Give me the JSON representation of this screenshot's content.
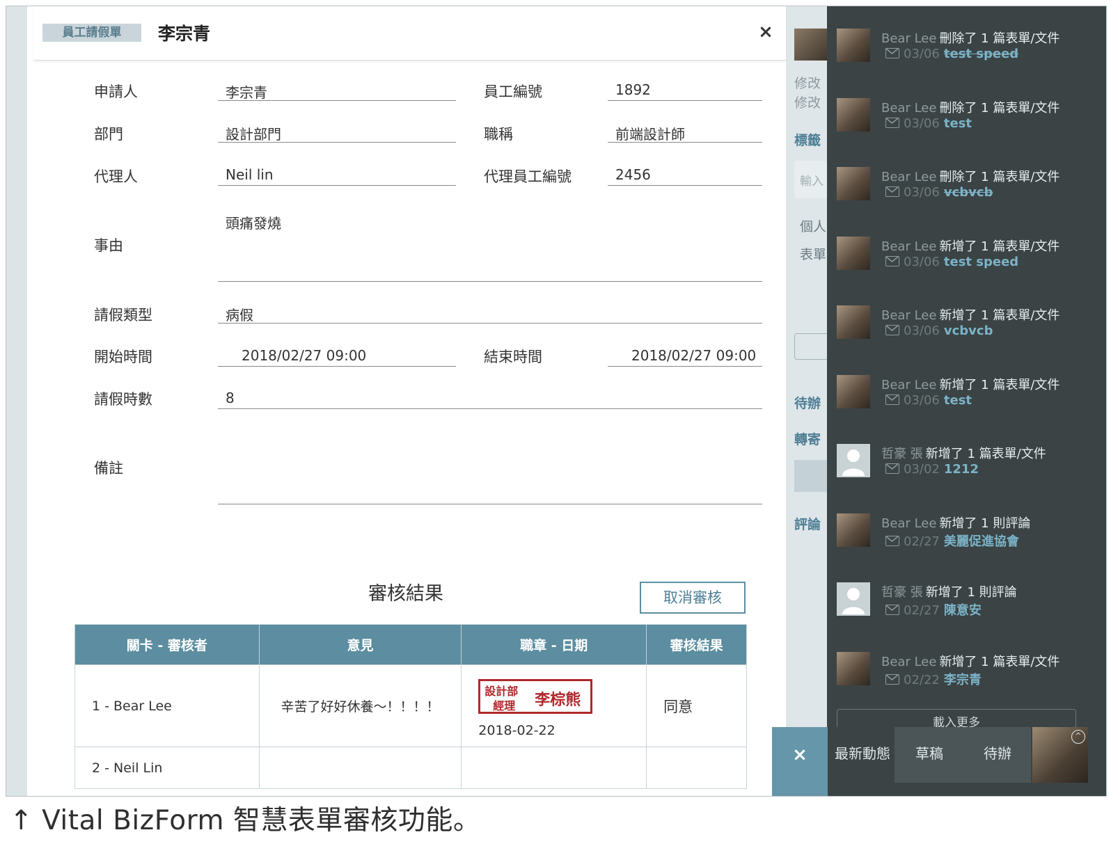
{
  "form": {
    "tag": "員工請假單",
    "title": "李宗青",
    "close": "×",
    "fields": {
      "applicant_label": "申請人",
      "applicant_value": "李宗青",
      "emp_no_label": "員工編號",
      "emp_no_value": "1892",
      "dept_label": "部門",
      "dept_value": "設計部門",
      "job_label": "職稱",
      "job_value": "前端設計師",
      "agent_label": "代理人",
      "agent_value": "Neil lin",
      "agent_no_label": "代理員工編號",
      "agent_no_value": "2456",
      "reason_label": "事由",
      "reason_value": "頭痛發燒",
      "leave_type_label": "請假類型",
      "leave_type_value": "病假",
      "start_label": "開始時間",
      "start_value": "2018/02/27 09:00",
      "end_label": "結束時間",
      "end_value": "2018/02/27 09:00",
      "hours_label": "請假時數",
      "hours_value": "8",
      "note_label": "備註",
      "note_value": ""
    }
  },
  "review": {
    "title": "審核結果",
    "cancel_button": "取消審核",
    "headers": [
      "關卡 - 審核者",
      "意見",
      "職章 - 日期",
      "審核結果"
    ],
    "rows": [
      {
        "stage": "1 - Bear Lee",
        "comment": "辛苦了好好休養～！！！！",
        "stamp_dept": "設計部",
        "stamp_title": "經理",
        "stamp_name": "李棕熊",
        "date": "2018-02-22",
        "result": "同意"
      },
      {
        "stage": "2 - Neil Lin",
        "comment": "",
        "stamp_dept": "",
        "stamp_title": "",
        "stamp_name": "",
        "date": "",
        "result": ""
      }
    ]
  },
  "side_strip": {
    "items": [
      "修改",
      "修改",
      "標籤",
      "輸入",
      "個人",
      "表單",
      "待辦",
      "轉寄",
      "評論"
    ]
  },
  "feed": {
    "items": [
      {
        "user": "Bear Lee",
        "action": "刪除了 1 篇表單/文件",
        "date": "03/06",
        "target": "test speed",
        "deleted": true,
        "avatar": "bear"
      },
      {
        "user": "Bear Lee",
        "action": "刪除了 1 篇表單/文件",
        "date": "03/06",
        "target": "test",
        "deleted": false,
        "avatar": "bear"
      },
      {
        "user": "Bear Lee",
        "action": "刪除了 1 篇表單/文件",
        "date": "03/06",
        "target": "vcbvcb",
        "deleted": true,
        "avatar": "bear"
      },
      {
        "user": "Bear Lee",
        "action": "新增了 1 篇表單/文件",
        "date": "03/06",
        "target": "test speed",
        "deleted": false,
        "avatar": "bear"
      },
      {
        "user": "Bear Lee",
        "action": "新增了 1 篇表單/文件",
        "date": "03/06",
        "target": "vcbvcb",
        "deleted": false,
        "avatar": "bear"
      },
      {
        "user": "Bear Lee",
        "action": "新增了 1 篇表單/文件",
        "date": "03/06",
        "target": "test",
        "deleted": false,
        "avatar": "bear"
      },
      {
        "user": "哲豪 張",
        "action": "新增了 1 篇表單/文件",
        "date": "03/02",
        "target": "1212",
        "deleted": false,
        "avatar": "person"
      },
      {
        "user": "Bear Lee",
        "action": "新增了 1 則評論",
        "date": "02/27",
        "target": "美麗促進協會",
        "deleted": false,
        "avatar": "bear"
      },
      {
        "user": "哲豪 張",
        "action": "新增了 1 則評論",
        "date": "02/27",
        "target": "陳意安",
        "deleted": false,
        "avatar": "person"
      },
      {
        "user": "Bear Lee",
        "action": "新增了 1 篇表單/文件",
        "date": "02/22",
        "target": "李宗青",
        "deleted": false,
        "avatar": "bear"
      }
    ],
    "load_more": "載入更多"
  },
  "bottom_bar": {
    "close": "×",
    "tabs": [
      "最新動態",
      "草稿",
      "待辦"
    ]
  },
  "caption": "↑ Vital BizForm 智慧表單審核功能。",
  "colors": {
    "accent": "#5c8da0",
    "dark_panel": "#3b4345",
    "link": "#7bb3c7",
    "stamp": "#b0282c"
  }
}
